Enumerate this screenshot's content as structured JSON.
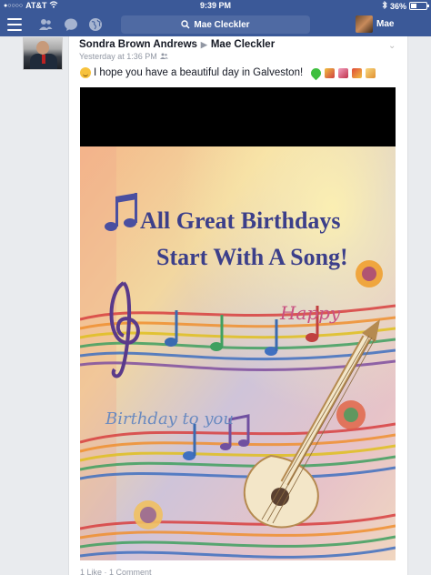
{
  "status_bar": {
    "carrier": "AT&T",
    "time": "9:39 PM",
    "battery_text": "36%",
    "battery_level": 0.36
  },
  "nav": {
    "search_text": "Mae Cleckler",
    "profile_name": "Mae"
  },
  "post": {
    "author": "Sondra Brown Andrews",
    "recipient": "Mae Cleckler",
    "timestamp": "Yesterday at 1:36 PM",
    "message": "I hope you have a beautiful day in Galveston!",
    "footer": "1 Like · 1 Comment"
  },
  "card_image": {
    "headline_1": "All Great Birthdays",
    "headline_2": "Start With A Song!",
    "script_top": "Happy",
    "script_bottom": "Birthday to you"
  },
  "colors": {
    "facebook_blue": "#3b5998",
    "background": "#e9ebee"
  }
}
